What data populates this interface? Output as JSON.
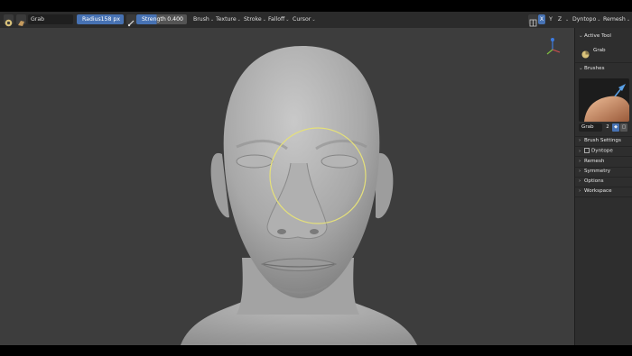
{
  "toolbar": {
    "tool_name": "Grab",
    "radius_label": "Radius",
    "radius_value": "158 px",
    "strength_label": "Strength",
    "strength_value": "0.400",
    "menus": [
      "Brush",
      "Texture",
      "Stroke",
      "Falloff",
      "Cursor"
    ],
    "axes": [
      "X",
      "Y",
      "Z"
    ],
    "dyntopo_label": "Dyntopo",
    "remesh_label": "Remesh"
  },
  "panel": {
    "active_tool_header": "Active Tool",
    "active_tool_name": "Grab",
    "brushes_header": "Brushes",
    "brush_name": "Grab",
    "brush_user_count": "2",
    "sections": [
      "Brush Settings",
      "Dyntope",
      "Remesh",
      "Symmetry",
      "Options",
      "Workspace"
    ]
  },
  "colors": {
    "radius_slider": "#4772b3",
    "brush_cursor": "#e5e07a",
    "active_toggle": "#4772b3"
  },
  "icons": [
    "sculpt-mode-icon",
    "grab-brush-icon",
    "paint-icon",
    "mirror-icon",
    "gizmo-icon"
  ]
}
